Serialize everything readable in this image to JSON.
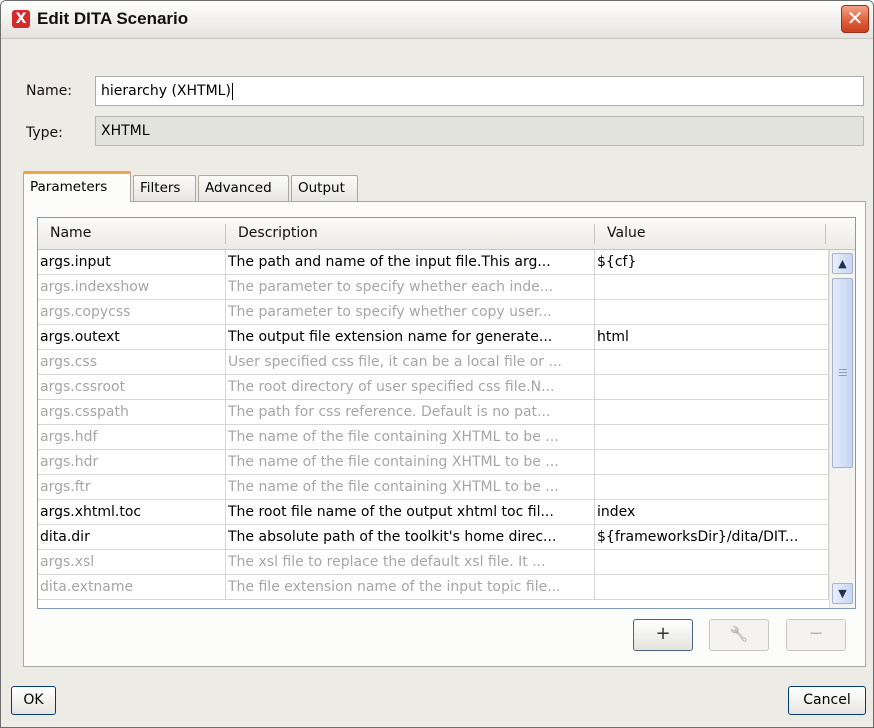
{
  "window": {
    "title": "Edit DITA Scenario",
    "close_glyph": "✕",
    "app_icon_glyph": "X"
  },
  "form": {
    "name_label": "Name:",
    "name_value": "hierarchy (XHTML)",
    "type_label": "Type:",
    "type_value": "XHTML"
  },
  "tabs": [
    {
      "label": "Parameters",
      "active": true
    },
    {
      "label": "Filters",
      "active": false
    },
    {
      "label": "Advanced",
      "active": false
    },
    {
      "label": "Output",
      "active": false
    }
  ],
  "table": {
    "columns": [
      "Name",
      "Description",
      "Value"
    ],
    "rows": [
      {
        "name": "args.input",
        "description": "The path and name of the input file.This arg...",
        "value": "${cf}",
        "set": true
      },
      {
        "name": "args.indexshow",
        "description": "The parameter to specify whether each inde...",
        "value": "",
        "set": false
      },
      {
        "name": "args.copycss",
        "description": "The parameter to specify whether copy user...",
        "value": "",
        "set": false
      },
      {
        "name": "args.outext",
        "description": "The output file extension name for generate...",
        "value": "html",
        "set": true
      },
      {
        "name": "args.css",
        "description": "User specified css file, it can be a local file or ...",
        "value": "",
        "set": false
      },
      {
        "name": "args.cssroot",
        "description": "The root directory of user specified css file.N...",
        "value": "",
        "set": false
      },
      {
        "name": "args.csspath",
        "description": "The path for css reference. Default is no pat...",
        "value": "",
        "set": false
      },
      {
        "name": "args.hdf",
        "description": "The name of the file containing XHTML to be ...",
        "value": "",
        "set": false
      },
      {
        "name": "args.hdr",
        "description": "The name of the file containing XHTML to be ...",
        "value": "",
        "set": false
      },
      {
        "name": "args.ftr",
        "description": "The name of the file containing XHTML to be ...",
        "value": "",
        "set": false
      },
      {
        "name": "args.xhtml.toc",
        "description": "The root file name of the output xhtml toc fil...",
        "value": "index",
        "set": true
      },
      {
        "name": "dita.dir",
        "description": "The absolute path of the toolkit's home direc...",
        "value": "${frameworksDir}/dita/DIT...",
        "set": true
      },
      {
        "name": "args.xsl",
        "description": "The xsl file to replace the default xsl file. It ...",
        "value": "",
        "set": false
      },
      {
        "name": "dita.extname",
        "description": "The file extension name of the input topic file...",
        "value": "",
        "set": false
      }
    ]
  },
  "scrollbar": {
    "up_glyph": "▲",
    "down_glyph": "▼"
  },
  "actions": {
    "add_glyph": "+",
    "edit_glyph": "🔧",
    "remove_glyph": "−"
  },
  "buttons": {
    "ok": "OK",
    "cancel": "Cancel"
  }
}
